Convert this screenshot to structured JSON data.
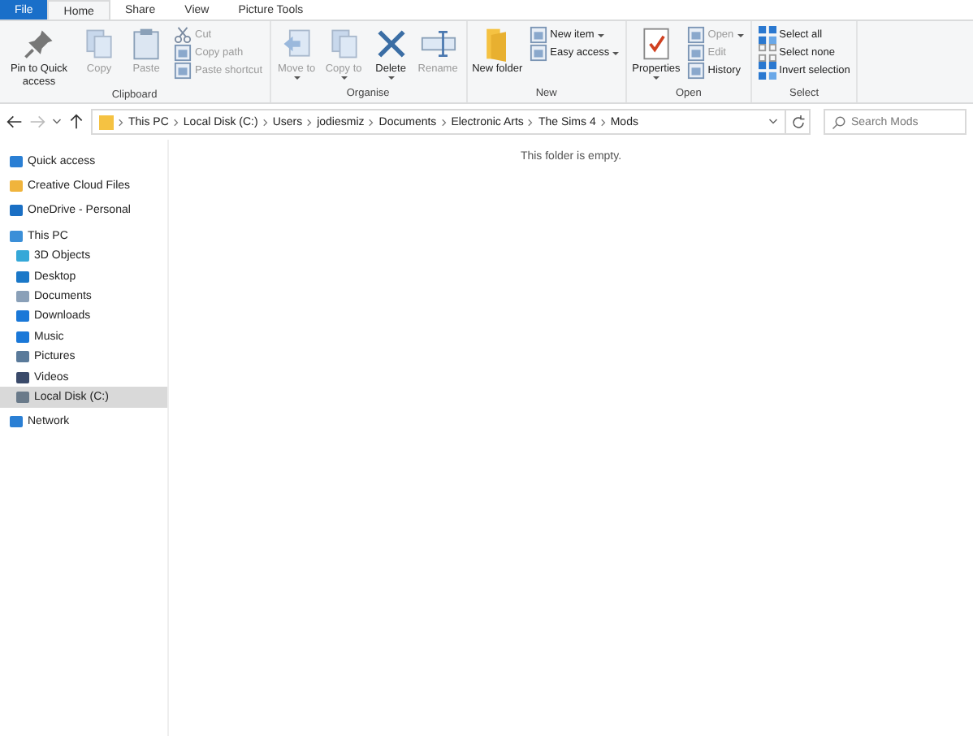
{
  "tabs": [
    {
      "label": "File",
      "selected": false,
      "kind": "file"
    },
    {
      "label": "Home",
      "selected": true,
      "kind": "tab"
    },
    {
      "label": "Share",
      "selected": false,
      "kind": "tab"
    },
    {
      "label": "View",
      "selected": false,
      "kind": "tab"
    },
    {
      "label": "Picture Tools",
      "selected": false,
      "kind": "tab"
    }
  ],
  "ribbon": [
    {
      "name": "Clipboard",
      "buttons": [
        {
          "label": "Pin to Quick access",
          "kind": "large",
          "disabled": false,
          "dropdown": false
        },
        {
          "label": "Copy",
          "kind": "large",
          "disabled": true,
          "dropdown": false
        },
        {
          "label": "Paste",
          "kind": "large",
          "disabled": true,
          "dropdown": false
        },
        {
          "label": "Cut",
          "kind": "small",
          "disabled": true,
          "dropdown": false
        },
        {
          "label": "Copy path",
          "kind": "small",
          "disabled": true,
          "dropdown": false
        },
        {
          "label": "Paste shortcut",
          "kind": "small",
          "disabled": true,
          "dropdown": false
        }
      ]
    },
    {
      "name": "Organise",
      "buttons": [
        {
          "label": "Move to",
          "kind": "large",
          "disabled": true,
          "dropdown": true
        },
        {
          "label": "Copy to",
          "kind": "large",
          "disabled": true,
          "dropdown": true
        },
        {
          "label": "Delete",
          "kind": "large",
          "disabled": false,
          "dropdown": true
        },
        {
          "label": "Rename",
          "kind": "large",
          "disabled": true,
          "dropdown": false
        }
      ]
    },
    {
      "name": "New",
      "buttons": [
        {
          "label": "New folder",
          "kind": "large",
          "disabled": false,
          "dropdown": false
        },
        {
          "label": "New item",
          "kind": "small",
          "disabled": false,
          "dropdown": true
        },
        {
          "label": "Easy access",
          "kind": "small",
          "disabled": false,
          "dropdown": true
        }
      ]
    },
    {
      "name": "Open",
      "buttons": [
        {
          "label": "Properties",
          "kind": "large",
          "disabled": false,
          "dropdown": true
        },
        {
          "label": "Open",
          "kind": "small",
          "disabled": true,
          "dropdown": true
        },
        {
          "label": "Edit",
          "kind": "small",
          "disabled": true,
          "dropdown": false
        },
        {
          "label": "History",
          "kind": "small",
          "disabled": false,
          "dropdown": false
        }
      ]
    },
    {
      "name": "Select",
      "buttons": [
        {
          "label": "Select all",
          "kind": "small",
          "disabled": false,
          "dropdown": false
        },
        {
          "label": "Select none",
          "kind": "small",
          "disabled": false,
          "dropdown": false
        },
        {
          "label": "Invert selection",
          "kind": "small",
          "disabled": false,
          "dropdown": false
        }
      ]
    }
  ],
  "nav": {
    "back_disabled": false,
    "forward_disabled": true
  },
  "address": {
    "crumbs": [
      "This PC",
      "Local Disk (C:)",
      "Users",
      "jodiesmiz",
      "Documents",
      "Electronic Arts",
      "The Sims 4",
      "Mods"
    ]
  },
  "search": {
    "placeholder": "Search Mods"
  },
  "sidebar": {
    "items": [
      {
        "label": "Quick access",
        "selected": false
      },
      {
        "label": "Creative Cloud Files",
        "selected": false
      },
      {
        "label": "OneDrive - Personal",
        "selected": false
      },
      {
        "label": "This PC",
        "selected": false,
        "children": [
          {
            "label": "3D Objects",
            "selected": false
          },
          {
            "label": "Desktop",
            "selected": false
          },
          {
            "label": "Documents",
            "selected": false
          },
          {
            "label": "Downloads",
            "selected": false
          },
          {
            "label": "Music",
            "selected": false
          },
          {
            "label": "Pictures",
            "selected": false
          },
          {
            "label": "Videos",
            "selected": false
          },
          {
            "label": "Local Disk (C:)",
            "selected": true
          }
        ]
      },
      {
        "label": "Network",
        "selected": false
      }
    ]
  },
  "content": {
    "empty_message": "This folder is empty."
  }
}
